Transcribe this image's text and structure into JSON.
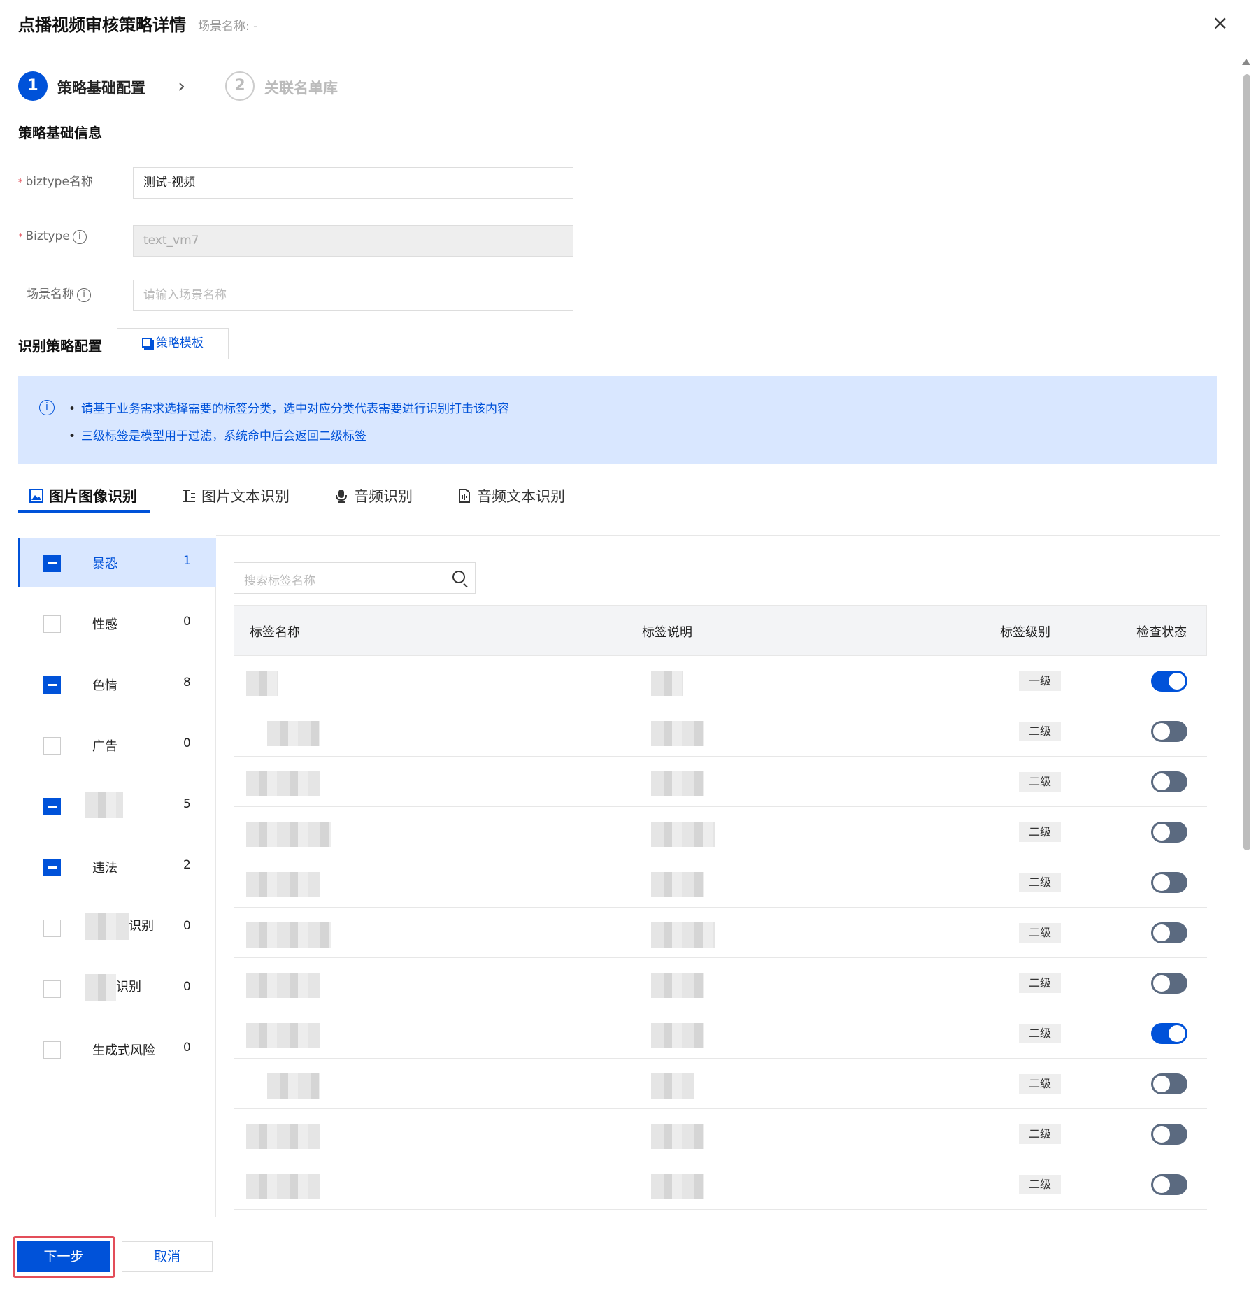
{
  "header": {
    "title": "点播视频审核策略详情",
    "subtitle": "场景名称: -",
    "close_icon": "×"
  },
  "steps": [
    {
      "num": "1",
      "label": "策略基础配置"
    },
    {
      "num": "2",
      "label": "关联名单库"
    }
  ],
  "sections": {
    "basic_info": "策略基础信息",
    "strategy_config": "识别策略配置"
  },
  "form": {
    "biztype_name_label": "biztype名称",
    "biztype_name_value": "测试-视频",
    "biztype_label": "Biztype",
    "biztype_value": "text_vm7",
    "scene_label": "场景名称",
    "scene_placeholder": "请输入场景名称"
  },
  "template_button": "策略模板",
  "notice": {
    "line1": "请基于业务需求选择需要的标签分类，选中对应分类代表需要进行识别打击该内容",
    "line2": "三级标签是模型用于过滤，系统命中后会返回二级标签"
  },
  "tabs": [
    "图片图像识别",
    "图片文本识别",
    "音频识别",
    "音频文本识别"
  ],
  "categories": [
    {
      "name": "暴恐",
      "count": "1",
      "state": "partial",
      "active": true
    },
    {
      "name": "性感",
      "count": "0",
      "state": "none"
    },
    {
      "name": "色情",
      "count": "8",
      "state": "partial"
    },
    {
      "name": "广告",
      "count": "0",
      "state": "none"
    },
    {
      "name": "",
      "count": "5",
      "state": "partial"
    },
    {
      "name": "违法",
      "count": "2",
      "state": "partial"
    },
    {
      "name": "识别",
      "count": "0",
      "state": "none"
    },
    {
      "name": "识别",
      "count": "0",
      "state": "none"
    },
    {
      "name": "生成式风险",
      "count": "0",
      "state": "none"
    }
  ],
  "search_placeholder": "搜索标签名称",
  "table": {
    "headers": [
      "标签名称",
      "标签说明",
      "标签级别",
      "检查状态"
    ],
    "rows": [
      {
        "level": "一级",
        "enabled": true
      },
      {
        "level": "二级",
        "enabled": false
      },
      {
        "level": "二级",
        "enabled": false
      },
      {
        "level": "二级",
        "enabled": false
      },
      {
        "level": "二级",
        "enabled": false
      },
      {
        "level": "二级",
        "enabled": false
      },
      {
        "level": "二级",
        "enabled": false
      },
      {
        "level": "二级",
        "enabled": true
      },
      {
        "level": "二级",
        "enabled": false
      },
      {
        "level": "二级",
        "enabled": false
      },
      {
        "level": "二级",
        "enabled": false
      }
    ]
  },
  "footer": {
    "next": "下一步",
    "cancel": "取消"
  },
  "colors": {
    "primary": "#0052d9",
    "notice_bg": "#d9e7ff",
    "highlight": "#e34d59"
  }
}
